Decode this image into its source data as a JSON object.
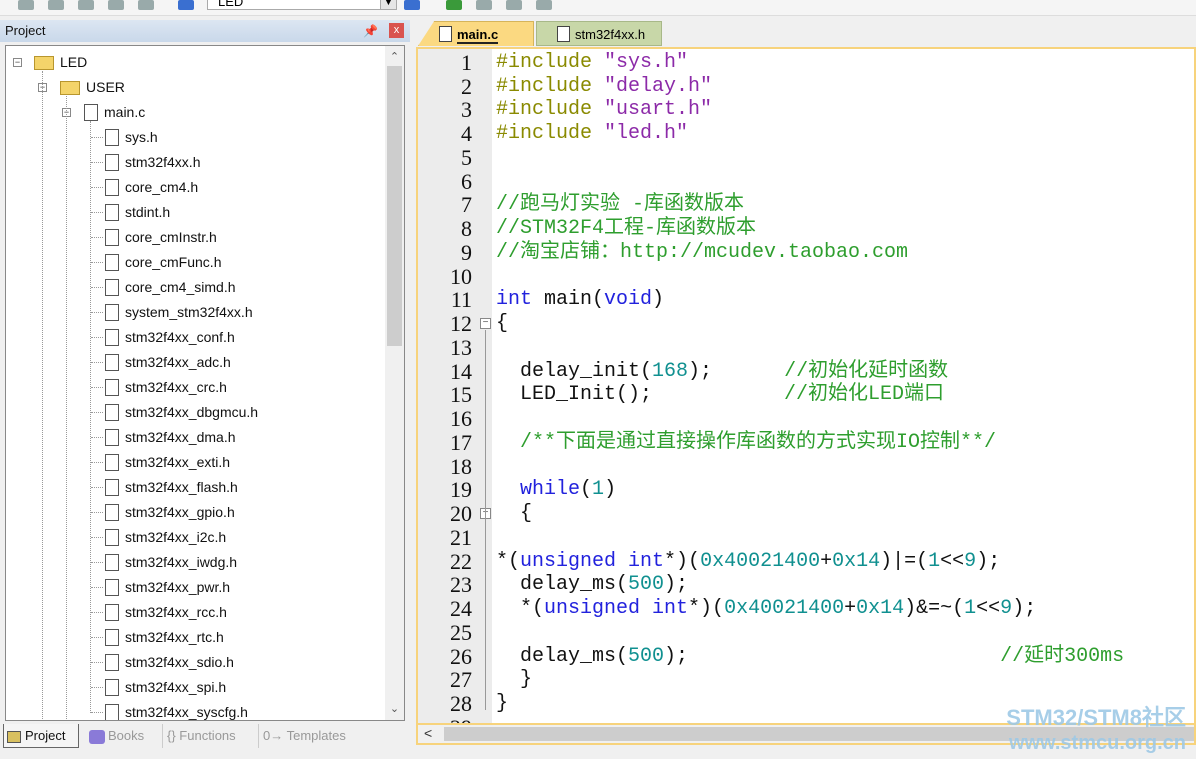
{
  "toolbar": {
    "target": "LED"
  },
  "project_panel": {
    "title": "Project",
    "pin": "▕",
    "close": "x"
  },
  "tree": {
    "root": "LED",
    "group": "USER",
    "file": "main.c",
    "includes": [
      "sys.h",
      "stm32f4xx.h",
      "core_cm4.h",
      "stdint.h",
      "core_cmInstr.h",
      "core_cmFunc.h",
      "core_cm4_simd.h",
      "system_stm32f4xx.h",
      "stm32f4xx_conf.h",
      "stm32f4xx_adc.h",
      "stm32f4xx_crc.h",
      "stm32f4xx_dbgmcu.h",
      "stm32f4xx_dma.h",
      "stm32f4xx_exti.h",
      "stm32f4xx_flash.h",
      "stm32f4xx_gpio.h",
      "stm32f4xx_i2c.h",
      "stm32f4xx_iwdg.h",
      "stm32f4xx_pwr.h",
      "stm32f4xx_rcc.h",
      "stm32f4xx_rtc.h",
      "stm32f4xx_sdio.h",
      "stm32f4xx_spi.h",
      "stm32f4xx_syscfg.h"
    ]
  },
  "bottom_tabs": [
    {
      "label": "Project",
      "active": true
    },
    {
      "label": "Books"
    },
    {
      "label": "{} Functions"
    },
    {
      "label": "0→ Templates"
    }
  ],
  "editor": {
    "tabs": [
      {
        "label": "main.c",
        "active": true
      },
      {
        "label": "stm32f4xx.h"
      }
    ],
    "lines": [
      [
        [
          "pp",
          "#include "
        ],
        [
          "str",
          "\"sys.h\""
        ]
      ],
      [
        [
          "pp",
          "#include "
        ],
        [
          "str",
          "\"delay.h\""
        ]
      ],
      [
        [
          "pp",
          "#include "
        ],
        [
          "str",
          "\"usart.h\""
        ]
      ],
      [
        [
          "pp",
          "#include "
        ],
        [
          "str",
          "\"led.h\""
        ]
      ],
      [],
      [],
      [
        [
          "cm",
          "//跑马灯实验 -库函数版本"
        ]
      ],
      [
        [
          "cm",
          "//STM32F4工程-库函数版本"
        ]
      ],
      [
        [
          "cm",
          "//淘宝店铺：http://mcudev.taobao.com"
        ]
      ],
      [],
      [
        [
          "kw",
          "int"
        ],
        [
          "tx",
          " main("
        ],
        [
          "kw",
          "void"
        ],
        [
          "tx",
          ")"
        ]
      ],
      [
        [
          "tx",
          "{"
        ]
      ],
      [],
      [
        [
          "tx",
          "  delay_init("
        ],
        [
          "num",
          "168"
        ],
        [
          "tx",
          ");      "
        ],
        [
          "cm",
          "//初始化延时函数"
        ]
      ],
      [
        [
          "tx",
          "  LED_Init();           "
        ],
        [
          "cm",
          "//初始化LED端口"
        ]
      ],
      [],
      [
        [
          "cm",
          "  /**下面是通过直接操作库函数的方式实现IO控制**/"
        ]
      ],
      [],
      [
        [
          "tx",
          "  "
        ],
        [
          "kw",
          "while"
        ],
        [
          "tx",
          "("
        ],
        [
          "num",
          "1"
        ],
        [
          "tx",
          ")"
        ]
      ],
      [
        [
          "tx",
          "  {"
        ]
      ],
      [],
      [
        [
          "tx",
          "*("
        ],
        [
          "kw",
          "unsigned int"
        ],
        [
          "tx",
          "*)("
        ],
        [
          "num",
          "0x40021400"
        ],
        [
          "tx",
          "+"
        ],
        [
          "num",
          "0x14"
        ],
        [
          "tx",
          ")|=("
        ],
        [
          "num",
          "1"
        ],
        [
          "tx",
          "<<"
        ],
        [
          "num",
          "9"
        ],
        [
          "tx",
          ");"
        ]
      ],
      [
        [
          "tx",
          "  delay_ms("
        ],
        [
          "num",
          "500"
        ],
        [
          "tx",
          ");"
        ]
      ],
      [
        [
          "tx",
          "  *("
        ],
        [
          "kw",
          "unsigned int"
        ],
        [
          "tx",
          "*)("
        ],
        [
          "num",
          "0x40021400"
        ],
        [
          "tx",
          "+"
        ],
        [
          "num",
          "0x14"
        ],
        [
          "tx",
          ")&=~("
        ],
        [
          "num",
          "1"
        ],
        [
          "tx",
          "<<"
        ],
        [
          "num",
          "9"
        ],
        [
          "tx",
          ");"
        ]
      ],
      [],
      [
        [
          "tx",
          "  delay_ms("
        ],
        [
          "num",
          "500"
        ],
        [
          "tx",
          ");                          "
        ],
        [
          "cm",
          "//延时300ms"
        ]
      ],
      [
        [
          "tx",
          "  }"
        ]
      ],
      [
        [
          "tx",
          "}"
        ]
      ],
      []
    ],
    "fold_lines": [
      12,
      20
    ]
  },
  "watermark": {
    "line1": "STM32/STM8社区",
    "line2": "www.stmcu.org.cn"
  }
}
